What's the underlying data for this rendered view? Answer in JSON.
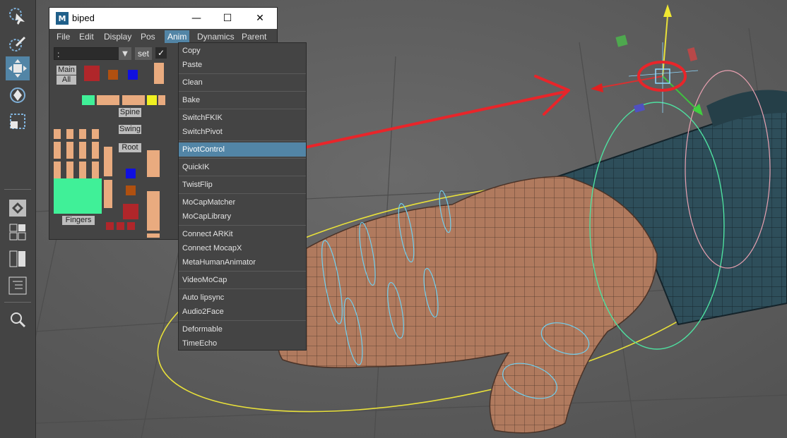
{
  "window": {
    "title": "biped",
    "app_icon": "M",
    "minimize": "—",
    "maximize": "☐",
    "close": "✕"
  },
  "menubar": {
    "items": [
      "File",
      "Edit",
      "Display",
      "Pos",
      "Anim",
      "Dynamics",
      "Parent"
    ],
    "open_item": "Anim"
  },
  "picker": {
    "selector_value": ":",
    "selector_arrow": "▼",
    "set_label": "set",
    "checkbox_glyph": "✓",
    "labels": {
      "main": "Main",
      "all": "All",
      "spine": "Spine",
      "swing": "Swing",
      "root": "Root",
      "fingers": "Fingers"
    }
  },
  "anim_menu": {
    "items": [
      {
        "label": "Copy"
      },
      {
        "label": "Paste"
      },
      {
        "label": "Clean"
      },
      {
        "label": "Bake"
      },
      {
        "label": "SwitchFKIK"
      },
      {
        "label": "SwitchPivot"
      },
      {
        "label": "PivotControl"
      },
      {
        "label": "QuickIK"
      },
      {
        "label": "TwistFlip"
      },
      {
        "label": "MoCapMatcher"
      },
      {
        "label": "MoCapLibrary"
      },
      {
        "label": "Connect ARKit"
      },
      {
        "label": "Connect MocapX"
      },
      {
        "label": "MetaHumanAnimator"
      },
      {
        "label": "VideoMoCap"
      },
      {
        "label": "Auto lipsync"
      },
      {
        "label": "Audio2Face"
      },
      {
        "label": "Deformable"
      },
      {
        "label": "TimeEcho"
      }
    ],
    "highlighted": "PivotControl"
  },
  "toolbox": {
    "tools": [
      "select-tool-icon",
      "paint-select-tool-icon",
      "move-tool-icon",
      "rotate-tool-icon",
      "scale-tool-icon"
    ],
    "active_tool": "move-tool-icon",
    "layout_icons": [
      "single-pane-layout-icon",
      "four-pane-layout-icon",
      "two-pane-layout-icon",
      "outliner-layout-icon",
      "zoom-icon"
    ]
  },
  "colors": {
    "accent": "#5285a6",
    "annotation": "#e8252a",
    "skin_picker": "#e9ab7f",
    "viewport_bg": "#5c5c5c"
  }
}
